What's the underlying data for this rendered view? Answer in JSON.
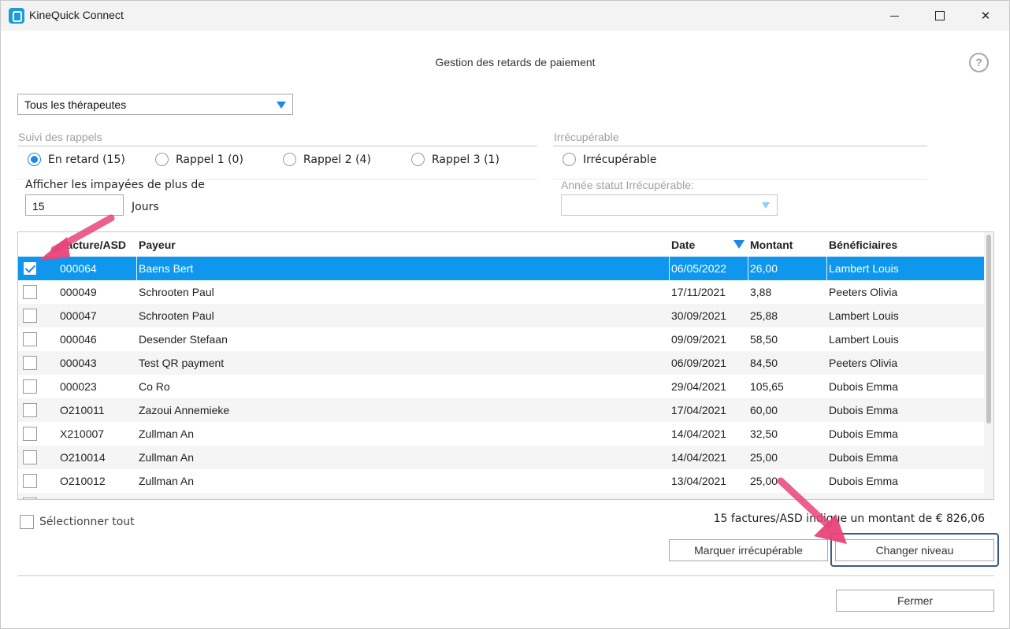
{
  "window": {
    "title": "KineQuick Connect",
    "minimize": "minimize",
    "maximize": "maximize",
    "close": "close"
  },
  "header": {
    "title": "Gestion des retards de paiement",
    "help": "?"
  },
  "therapist_filter": {
    "selected": "Tous les thérapeutes"
  },
  "reminders": {
    "label": "Suivi des rappels",
    "options": [
      {
        "label": "En retard (15)",
        "checked": true
      },
      {
        "label": "Rappel 1 (0)",
        "checked": false
      },
      {
        "label": "Rappel 2 (4)",
        "checked": false
      },
      {
        "label": "Rappel 3 (1)",
        "checked": false
      }
    ],
    "show_unpaid_label": "Afficher les impayées de plus de",
    "days_value": "15",
    "days_unit": "Jours"
  },
  "unrecoverable": {
    "label": "Irrécupérable",
    "option": "Irrécupérable",
    "year_label": "Année statut Irrécupérable:",
    "year_value": ""
  },
  "table": {
    "columns": {
      "invoice": "Facture/ASD",
      "payer": "Payeur",
      "date": "Date",
      "amount": "Montant",
      "beneficiaries": "Bénéficiaires"
    },
    "rows": [
      {
        "invoice": "000064",
        "payer": "Baens Bert",
        "date": "06/05/2022",
        "amount": "26,00",
        "beneficiary": "Lambert Louis",
        "checked": true
      },
      {
        "invoice": "000049",
        "payer": "Schrooten Paul",
        "date": "17/11/2021",
        "amount": "3,88",
        "beneficiary": "Peeters Olivia",
        "checked": false
      },
      {
        "invoice": "000047",
        "payer": "Schrooten Paul",
        "date": "30/09/2021",
        "amount": "25,88",
        "beneficiary": "Lambert Louis",
        "checked": false
      },
      {
        "invoice": "000046",
        "payer": "Desender Stefaan",
        "date": "09/09/2021",
        "amount": "58,50",
        "beneficiary": "Lambert Louis",
        "checked": false
      },
      {
        "invoice": "000043",
        "payer": "Test QR payment",
        "date": "06/09/2021",
        "amount": "84,50",
        "beneficiary": "Peeters Olivia",
        "checked": false
      },
      {
        "invoice": "000023",
        "payer": "Co Ro",
        "date": "29/04/2021",
        "amount": "105,65",
        "beneficiary": "Dubois Emma",
        "checked": false
      },
      {
        "invoice": "O210011",
        "payer": "Zazoui Annemieke",
        "date": "17/04/2021",
        "amount": "60,00",
        "beneficiary": "Dubois Emma",
        "checked": false
      },
      {
        "invoice": "X210007",
        "payer": "Zullman An",
        "date": "14/04/2021",
        "amount": "32,50",
        "beneficiary": "Dubois Emma",
        "checked": false
      },
      {
        "invoice": "O210014",
        "payer": "Zullman An",
        "date": "14/04/2021",
        "amount": "25,00",
        "beneficiary": "Dubois Emma",
        "checked": false
      },
      {
        "invoice": "O210012",
        "payer": "Zullman An",
        "date": "13/04/2021",
        "amount": "25,00",
        "beneficiary": "Dubois Emma",
        "checked": false
      }
    ]
  },
  "footer": {
    "select_all": "Sélectionner tout",
    "summary": "15 factures/ASD indique un montant de € 826,06",
    "mark_unrecoverable": "Marquer irrécupérable",
    "change_level": "Changer niveau",
    "close": "Fermer"
  },
  "colors": {
    "accent": "#1e88e5",
    "selected_row": "#0f97ee",
    "annotation_arrow": "#e8457a"
  }
}
